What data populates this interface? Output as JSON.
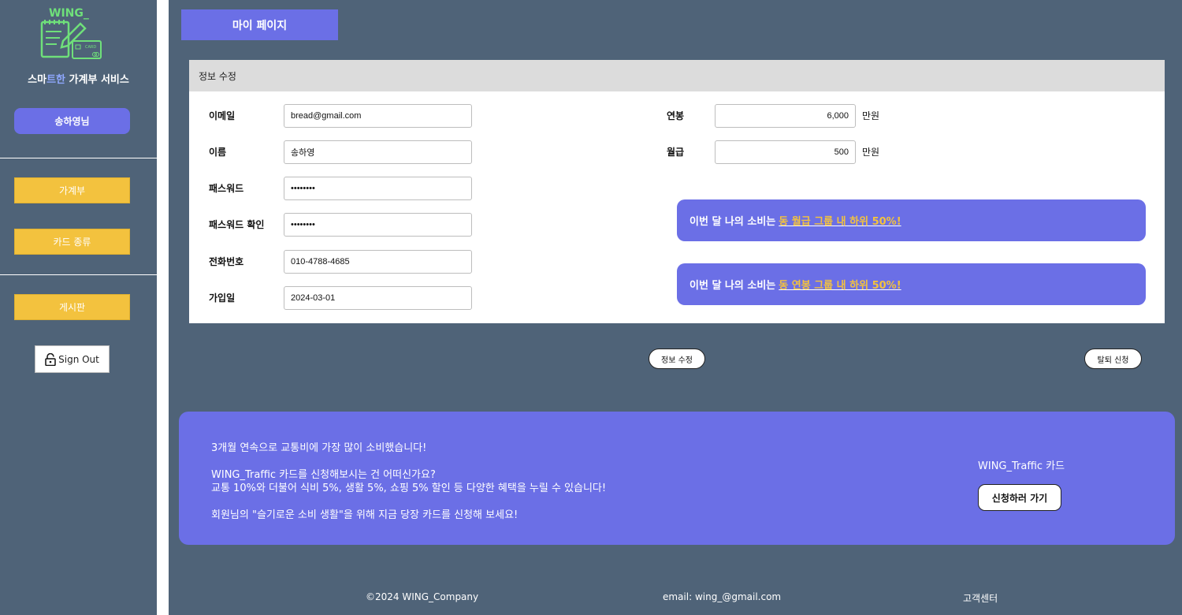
{
  "brand": {
    "logo_text": "WING_",
    "logo_card_text": "CARD",
    "service_prefix": "스마",
    "service_accent": "트한",
    "service_suffix": " 가계부 서비스"
  },
  "sidebar": {
    "user_label": "송하영님",
    "items": [
      {
        "label": "가계부"
      },
      {
        "label": "카드 종류"
      },
      {
        "label": "게시판"
      }
    ],
    "signout_label": "Sign Out"
  },
  "page_title": "마이 페이지",
  "panel": {
    "header": "정보 수정",
    "fields": [
      {
        "label": "이메일",
        "value": "bread@gmail.com"
      },
      {
        "label": "이름",
        "value": "송하영"
      },
      {
        "label": "패스워드",
        "value": "••••••••"
      },
      {
        "label": "패스워드 확인",
        "value": "••••••••"
      },
      {
        "label": "전화번호",
        "value": "010-4788-4685"
      },
      {
        "label": "가입일",
        "value": "2024-03-01"
      }
    ],
    "salary": [
      {
        "label": "연봉",
        "value": "6,000",
        "unit": "만원"
      },
      {
        "label": "월급",
        "value": "500",
        "unit": "만원"
      }
    ],
    "promos": [
      {
        "prefix": "이번 달 나의 소비는",
        "highlight": "동 월급 그룹 내 하위 50%!"
      },
      {
        "prefix": "이번 달 나의 소비는",
        "highlight": "동 연봉 그룹 내 하위 50%!"
      }
    ]
  },
  "actions": {
    "edit_label": "정보 수정",
    "withdraw_label": "탈퇴 신청"
  },
  "banner": {
    "line1": "3개월 연속으로 교통비에 가장 많이 소비했습니다!",
    "line2": "WING_Traffic 카드를 신청해보시는 건 어떠신가요?",
    "line3": "교통 10%와 더불어 식비 5%, 생활 5%, 쇼핑 5% 할인 등 다양한 혜택을 누릴 수 있습니다!",
    "line4": "회원님의 \"슬기로운 소비 생활\"을 위해 지금 당장 카드를 신청해 보세요!",
    "card_name": "WING_Traffic 카드",
    "apply_label": "신청하러 가기"
  },
  "footer": {
    "copyright": "©2024 WING_Company",
    "email": "email: wing_@gmail.com",
    "support": "고객센터"
  },
  "colors": {
    "background": "#4f6378",
    "accent": "#6b6fe6",
    "nav_button": "#f3c23e",
    "logo_green": "#6fe07a"
  }
}
